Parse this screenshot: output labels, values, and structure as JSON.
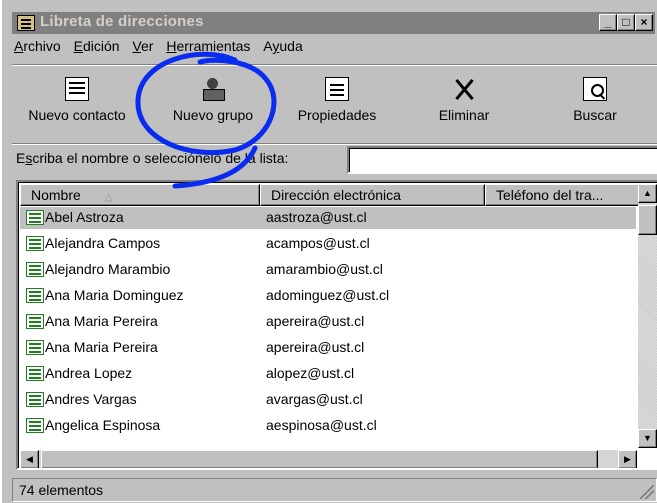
{
  "window": {
    "title": "Libreta de direcciones",
    "controls": {
      "minimize": "_",
      "maximize": "□",
      "close": "×"
    }
  },
  "menu": [
    {
      "label_underlined": "A",
      "label_rest": "rchivo"
    },
    {
      "label_underlined": "E",
      "label_rest": "dición"
    },
    {
      "label_underlined": "V",
      "label_rest": "er"
    },
    {
      "label_underlined": "H",
      "label_rest": "erramientas"
    },
    {
      "label_underlined": "y",
      "label_prefix": "A",
      "label_rest": "uda"
    }
  ],
  "toolbar": {
    "new_contact": {
      "label": "Nuevo contacto",
      "icon": "contact-card-icon"
    },
    "new_group": {
      "label": "Nuevo grupo",
      "icon": "group-icon"
    },
    "properties": {
      "label": "Propiedades",
      "icon": "properties-icon"
    },
    "delete": {
      "label": "Eliminar",
      "icon": "delete-icon"
    },
    "find": {
      "label": "Buscar",
      "icon": "find-icon"
    }
  },
  "search": {
    "label_prefix": "E",
    "label_underlined": "s",
    "label_rest": "criba el nombre o selecciónelo de la lista:",
    "value": ""
  },
  "list": {
    "columns": [
      {
        "label": "Nombre",
        "sort": "ascending"
      },
      {
        "label": "Dirección electrónica"
      },
      {
        "label": "Teléfono del tra..."
      }
    ],
    "rows": [
      {
        "name": "Abel Astroza",
        "email": "aastroza@ust.cl",
        "selected": true
      },
      {
        "name": "Alejandra Campos",
        "email": "acampos@ust.cl"
      },
      {
        "name": "Alejandro Marambio",
        "email": "amarambio@ust.cl"
      },
      {
        "name": "Ana Maria Dominguez",
        "email": "adominguez@ust.cl"
      },
      {
        "name": "Ana Maria Pereira",
        "email": "apereira@ust.cl"
      },
      {
        "name": "Ana Maria Pereira",
        "email": "apereira@ust.cl"
      },
      {
        "name": "Andrea Lopez",
        "email": "alopez@ust.cl"
      },
      {
        "name": "Andres Vargas",
        "email": "avargas@ust.cl"
      },
      {
        "name": "Angelica Espinosa",
        "email": "aespinosa@ust.cl"
      }
    ]
  },
  "status": {
    "text": "74 elementos"
  },
  "annotation": {
    "color": "#0a2cf0",
    "target": "Nuevo grupo"
  },
  "colors": {
    "title_bar_inactive": "#808080",
    "face": "#c0c0c0",
    "row_selected": "#c0c0c0"
  }
}
